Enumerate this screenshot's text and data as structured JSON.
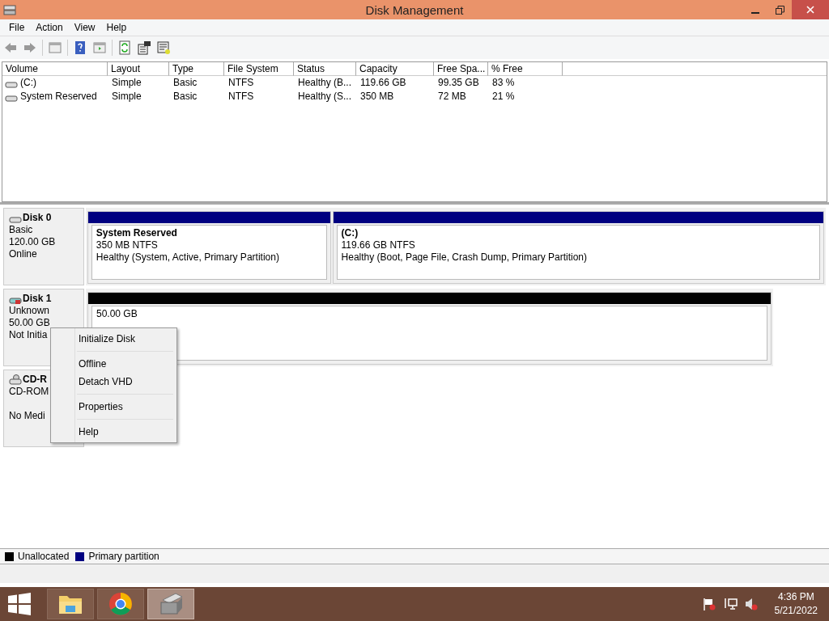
{
  "window": {
    "title": "Disk Management"
  },
  "menu": [
    "File",
    "Action",
    "View",
    "Help"
  ],
  "volumes": {
    "columns": [
      "Volume",
      "Layout",
      "Type",
      "File System",
      "Status",
      "Capacity",
      "Free Spa...",
      "% Free"
    ],
    "rows": [
      [
        "(C:)",
        "Simple",
        "Basic",
        "NTFS",
        "Healthy (B...",
        "119.66 GB",
        "99.35 GB",
        "83 %"
      ],
      [
        "System Reserved",
        "Simple",
        "Basic",
        "NTFS",
        "Healthy (S...",
        "350 MB",
        "72 MB",
        "21 %"
      ]
    ]
  },
  "disks": [
    {
      "kind": "disk",
      "name": "Disk 0",
      "lines": [
        "Basic",
        "120.00 GB",
        "Online"
      ],
      "partitions": [
        {
          "kind": "primary",
          "name": "System Reserved",
          "size": "350 MB NTFS",
          "status": "Healthy (System, Active, Primary Partition)"
        },
        {
          "kind": "primary",
          "name": "(C:)",
          "size": "119.66 GB NTFS",
          "status": "Healthy (Boot, Page File, Crash Dump, Primary Partition)"
        }
      ]
    },
    {
      "kind": "vhd",
      "name": "Disk 1",
      "lines": [
        "Unknown",
        "50.00 GB",
        "Not Initia"
      ],
      "partitions": [
        {
          "kind": "unallocated",
          "size": "50.00 GB"
        }
      ]
    },
    {
      "kind": "cdrom",
      "name": "CD-R",
      "lines": [
        "CD-ROM",
        "No Medi"
      ]
    }
  ],
  "legend": [
    {
      "label": "Unallocated",
      "color": "#000000"
    },
    {
      "label": "Primary partition",
      "color": "#000080"
    }
  ],
  "context_menu": [
    {
      "label": "Initialize Disk",
      "separator_after": true
    },
    {
      "label": "Offline",
      "separator_after": false
    },
    {
      "label": "Detach VHD",
      "separator_after": true
    },
    {
      "label": "Properties",
      "separator_after": true
    },
    {
      "label": "Help",
      "separator_after": false
    }
  ],
  "taskbar": {
    "apps": [
      {
        "kind": "explorer",
        "selected": false
      },
      {
        "kind": "chrome",
        "selected": false
      },
      {
        "kind": "diskmgmt",
        "selected": true
      }
    ],
    "time": "4:36 PM",
    "date": "5/21/2022"
  }
}
